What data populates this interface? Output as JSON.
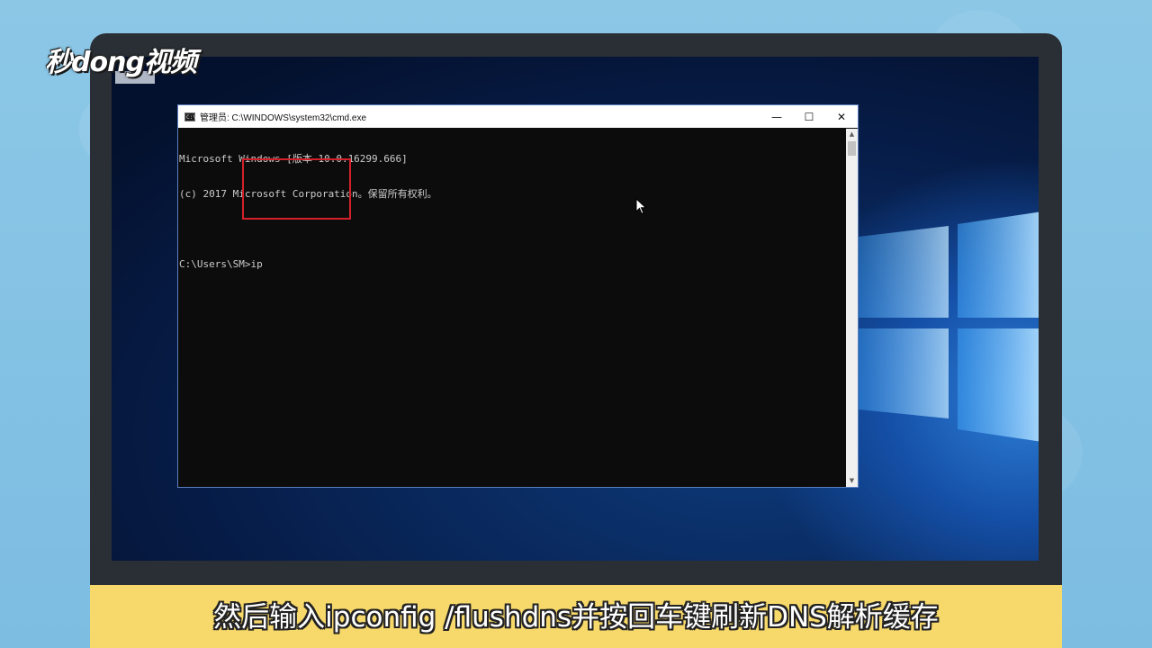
{
  "watermark": {
    "logo_text": "秒dong视频"
  },
  "cmd_window": {
    "title": "管理员: C:\\WINDOWS\\system32\\cmd.exe",
    "icon_text": "C:\\",
    "buttons": {
      "minimize": "—",
      "maximize": "☐",
      "close": "✕"
    },
    "lines": [
      "Microsoft Windows [版本 10.0.16299.666]",
      "(c) 2017 Microsoft Corporation。保留所有权利。",
      "",
      "C:\\Users\\SM>ip"
    ]
  },
  "subtitle": "然后输入ipconfig /flushdns并按回车键刷新DNS解析缓存",
  "colors": {
    "highlight_box": "#d4202a",
    "subtitle_bar": "#f7d86a",
    "console_bg": "#0c0c0c",
    "console_text": "#cccccc"
  }
}
